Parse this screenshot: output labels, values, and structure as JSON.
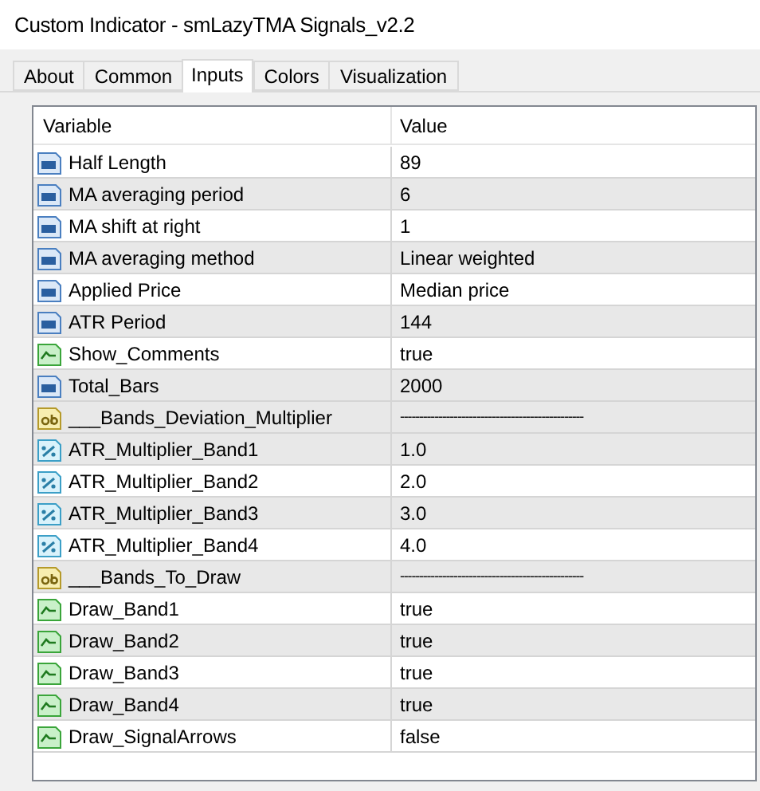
{
  "window": {
    "title": "Custom Indicator - smLazyTMA Signals_v2.2"
  },
  "tabs": [
    {
      "label": "About",
      "selected": false
    },
    {
      "label": "Common",
      "selected": false
    },
    {
      "label": "Inputs",
      "selected": true
    },
    {
      "label": "Colors",
      "selected": false
    },
    {
      "label": "Visualization",
      "selected": false
    }
  ],
  "table": {
    "columns": [
      "Variable",
      "Value"
    ],
    "rows": [
      {
        "kind": "int",
        "variable": "Half Length",
        "value": "89"
      },
      {
        "kind": "int",
        "variable": "MA averaging period",
        "value": "6"
      },
      {
        "kind": "int",
        "variable": "MA shift at right",
        "value": "1"
      },
      {
        "kind": "int",
        "variable": "MA averaging method",
        "value": "Linear weighted"
      },
      {
        "kind": "int",
        "variable": "Applied Price",
        "value": "Median price"
      },
      {
        "kind": "int",
        "variable": "ATR Period",
        "value": "144"
      },
      {
        "kind": "bool",
        "variable": "Show_Comments",
        "value": "true"
      },
      {
        "kind": "int",
        "variable": "Total_Bars",
        "value": "2000"
      },
      {
        "kind": "string",
        "variable": "___Bands_Deviation_Multiplier",
        "value": "------------------------------------------------"
      },
      {
        "kind": "double",
        "variable": "ATR_Multiplier_Band1",
        "value": "1.0"
      },
      {
        "kind": "double",
        "variable": "ATR_Multiplier_Band2",
        "value": "2.0"
      },
      {
        "kind": "double",
        "variable": "ATR_Multiplier_Band3",
        "value": "3.0"
      },
      {
        "kind": "double",
        "variable": "ATR_Multiplier_Band4",
        "value": "4.0"
      },
      {
        "kind": "string",
        "variable": "___Bands_To_Draw",
        "value": "------------------------------------------------"
      },
      {
        "kind": "bool",
        "variable": "Draw_Band1",
        "value": "true"
      },
      {
        "kind": "bool",
        "variable": "Draw_Band2",
        "value": "true"
      },
      {
        "kind": "bool",
        "variable": "Draw_Band3",
        "value": "true"
      },
      {
        "kind": "bool",
        "variable": "Draw_Band4",
        "value": "true"
      },
      {
        "kind": "bool",
        "variable": "Draw_SignalArrows",
        "value": "false"
      }
    ]
  }
}
